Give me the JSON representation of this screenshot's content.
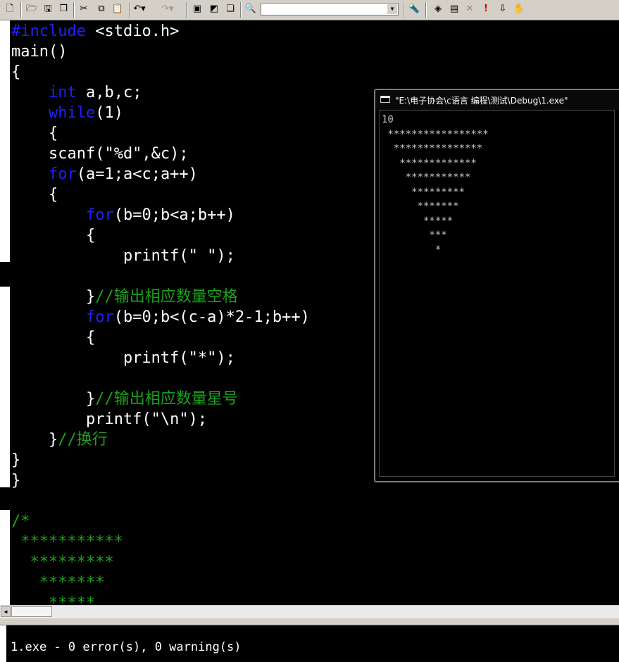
{
  "toolbar": {
    "buttons": [
      "new-file",
      "open-file",
      "save",
      "save-all",
      "cut",
      "copy",
      "paste",
      "undo",
      "redo",
      "workspace",
      "output",
      "window-list",
      "find-in-files",
      "find-combo",
      "find",
      "compile",
      "build",
      "stop-build",
      "execute",
      "go",
      "insert-breakpoint"
    ]
  },
  "code": {
    "lines": [
      [
        {
          "t": "#include",
          "c": "kw"
        },
        {
          "t": " <stdio.h>",
          "c": ""
        }
      ],
      [
        {
          "t": "main()",
          "c": ""
        }
      ],
      [
        {
          "t": "{",
          "c": ""
        }
      ],
      [
        {
          "t": "    ",
          "c": ""
        },
        {
          "t": "int",
          "c": "kw"
        },
        {
          "t": " a,b,c;",
          "c": ""
        }
      ],
      [
        {
          "t": "    ",
          "c": ""
        },
        {
          "t": "while",
          "c": "kw"
        },
        {
          "t": "(1)",
          "c": ""
        }
      ],
      [
        {
          "t": "    {",
          "c": ""
        }
      ],
      [
        {
          "t": "    scanf(\"%d\",&c);",
          "c": ""
        }
      ],
      [
        {
          "t": "    ",
          "c": ""
        },
        {
          "t": "for",
          "c": "kw"
        },
        {
          "t": "(a=1;a<c;a++)",
          "c": ""
        }
      ],
      [
        {
          "t": "    {",
          "c": ""
        }
      ],
      [
        {
          "t": "        ",
          "c": ""
        },
        {
          "t": "for",
          "c": "kw"
        },
        {
          "t": "(b=0;b<a;b++)",
          "c": ""
        }
      ],
      [
        {
          "t": "        {",
          "c": ""
        }
      ],
      [
        {
          "t": "            printf(\" \");",
          "c": ""
        }
      ],
      [
        {
          "t": "",
          "c": ""
        }
      ],
      [
        {
          "t": "        }",
          "c": ""
        },
        {
          "t": "//输出相应数量空格",
          "c": "cm"
        }
      ],
      [
        {
          "t": "        ",
          "c": ""
        },
        {
          "t": "for",
          "c": "kw"
        },
        {
          "t": "(b=0;b<(c-a)*2-1;b++)",
          "c": ""
        }
      ],
      [
        {
          "t": "        {",
          "c": ""
        }
      ],
      [
        {
          "t": "            printf(\"*\");",
          "c": ""
        }
      ],
      [
        {
          "t": "",
          "c": ""
        }
      ],
      [
        {
          "t": "        }",
          "c": ""
        },
        {
          "t": "//输出相应数量星号",
          "c": "cm"
        }
      ],
      [
        {
          "t": "        printf(\"\\n\");",
          "c": ""
        }
      ],
      [
        {
          "t": "    }",
          "c": ""
        },
        {
          "t": "//换行",
          "c": "cm"
        }
      ],
      [
        {
          "t": "}",
          "c": ""
        }
      ],
      [
        {
          "t": "}",
          "c": ""
        }
      ],
      [
        {
          "t": "",
          "c": ""
        }
      ],
      [
        {
          "t": "/*",
          "c": "cm"
        }
      ],
      [
        {
          "t": " ***********",
          "c": "cm"
        }
      ],
      [
        {
          "t": "  *********",
          "c": "cm"
        }
      ],
      [
        {
          "t": "   *******",
          "c": "cm"
        }
      ],
      [
        {
          "t": "    *****",
          "c": "cm"
        }
      ]
    ]
  },
  "console": {
    "title": "\"E:\\电子协会\\c语言 编程\\测试\\Debug\\1.exe\"",
    "lines": [
      "10",
      " *****************",
      "  ***************",
      "   *************",
      "    ***********",
      "     *********",
      "      *******",
      "       *****",
      "        ***",
      "         *"
    ]
  },
  "output": {
    "text": "1.exe - 0 error(s), 0 warning(s)"
  }
}
